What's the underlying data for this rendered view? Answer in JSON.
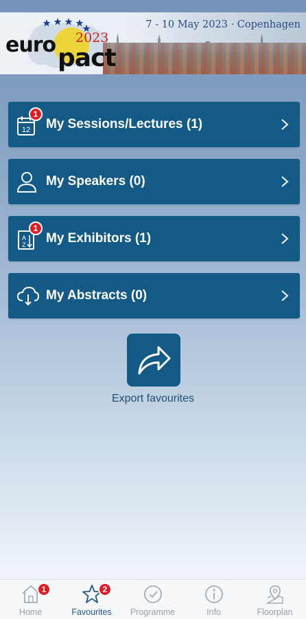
{
  "header": {
    "logo_euro": "euro",
    "logo_pact": "pact",
    "logo_year": "2023",
    "event_date": "7 - 10 May 2023 · Copenhagen"
  },
  "menu": {
    "items": [
      {
        "label": "My Sessions/Lectures (1)",
        "icon": "calendar-icon",
        "badge": "1"
      },
      {
        "label": "My Speakers (0)",
        "icon": "person-icon",
        "badge": ""
      },
      {
        "label": "My Exhibitors (1)",
        "icon": "az-list-icon",
        "badge": "1"
      },
      {
        "label": "My Abstracts (0)",
        "icon": "cloud-download-icon",
        "badge": ""
      }
    ]
  },
  "export": {
    "label": "Export favourites",
    "icon": "share-arrow-icon"
  },
  "bottom_nav": {
    "items": [
      {
        "label": "Home",
        "icon": "home-icon",
        "badge": "1",
        "active": false
      },
      {
        "label": "Favourites",
        "icon": "star-icon",
        "badge": "2",
        "active": true
      },
      {
        "label": "Programme",
        "icon": "clock-icon",
        "badge": "",
        "active": false
      },
      {
        "label": "Info",
        "icon": "info-icon",
        "badge": "",
        "active": false
      },
      {
        "label": "Floorplan",
        "icon": "map-pin-icon",
        "badge": "",
        "active": false
      }
    ]
  },
  "colors": {
    "card_bg": "#145a87",
    "badge_red": "#e31b23",
    "nav_active": "#27588a",
    "nav_inactive": "#9aa0a6"
  }
}
